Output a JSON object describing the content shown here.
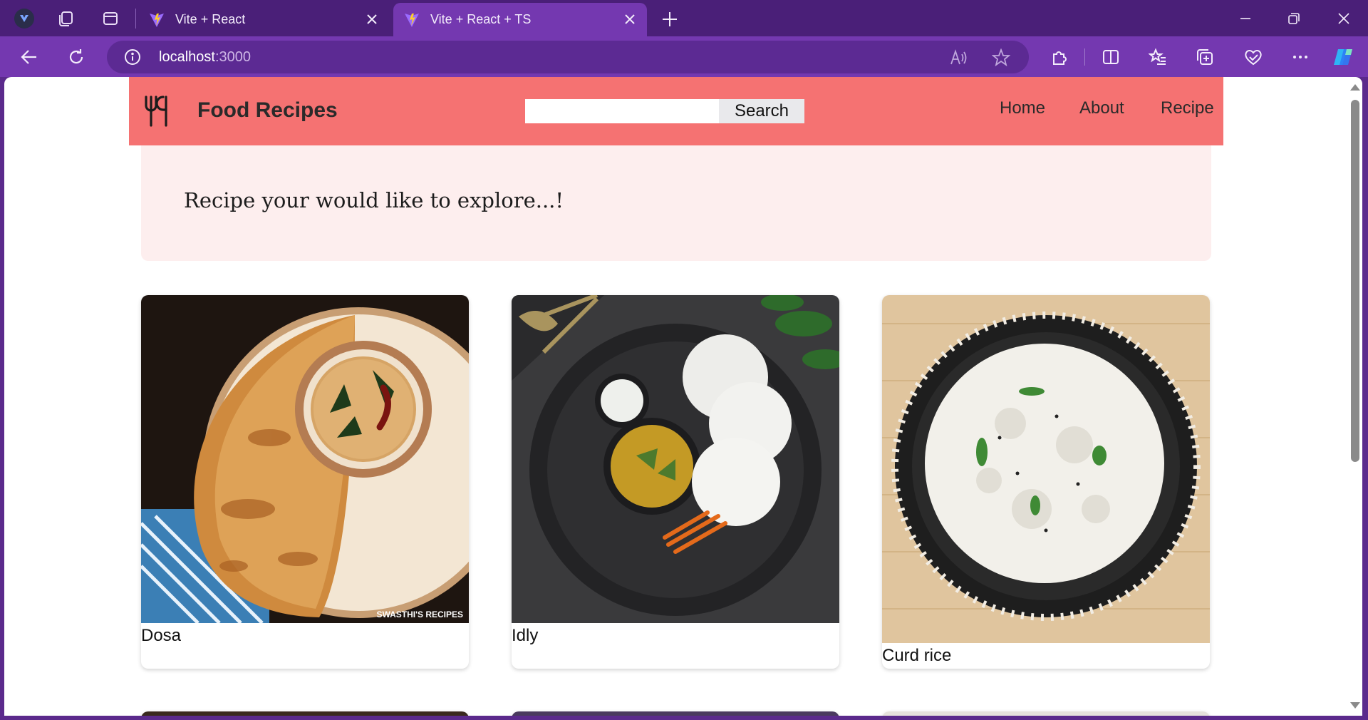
{
  "browser": {
    "tabs": [
      {
        "title": "Vite + React",
        "active": false
      },
      {
        "title": "Vite + React + TS",
        "active": true
      }
    ],
    "address": {
      "host": "localhost",
      "port": ":3000"
    }
  },
  "site": {
    "brand": "Food Recipes",
    "search": {
      "value": "",
      "button_label": "Search"
    },
    "nav": {
      "home": "Home",
      "about": "About",
      "recipe": "Recipe"
    },
    "hero": {
      "text": "Recipe your would like to explore...!"
    },
    "recipes": [
      {
        "name": "Dosa",
        "image": "dosa-photo",
        "watermark": "SWASTHI'S RECIPES"
      },
      {
        "name": "Idly",
        "image": "idly-photo"
      },
      {
        "name": "Curd rice",
        "image": "curd-rice-photo"
      }
    ]
  },
  "colors": {
    "navbar": "#f57272",
    "hero_bg": "#fdeeee",
    "browser_frame": "#7438b0"
  }
}
